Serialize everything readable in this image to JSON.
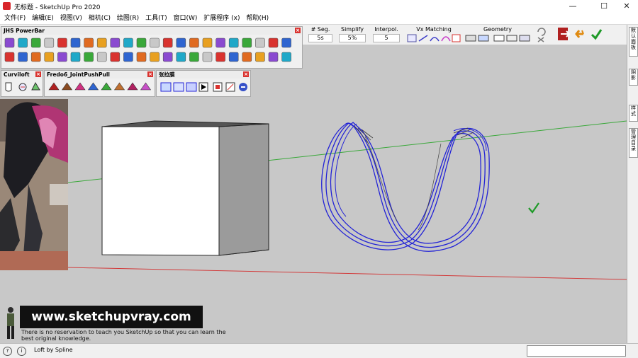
{
  "window": {
    "title": "无标题 - SketchUp Pro 2020"
  },
  "menu": [
    "文件(F)",
    "编辑(E)",
    "视图(V)",
    "相机(C)",
    "绘图(R)",
    "工具(T)",
    "窗口(W)",
    "扩展程序 (x)",
    "帮助(H)"
  ],
  "panels": {
    "jhs": {
      "title": "JHS PowerBar"
    },
    "curviloft": {
      "title": "Curviloft"
    },
    "fredo": {
      "title": "Fredo6_JointPushPull"
    },
    "zhang": {
      "title": "张拉膜"
    }
  },
  "spline_toolbar": {
    "seg": {
      "label": "# Seg.",
      "value": "5s"
    },
    "simplify": {
      "label": "Simplify",
      "value": "5%"
    },
    "interpol": {
      "label": "Interpol.",
      "value": "5"
    },
    "vx": {
      "label": "Vx Matching"
    },
    "geometry": {
      "label": "Geometry"
    }
  },
  "right_tabs": [
    "默认面板",
    "阴影",
    "样式",
    "管理目录"
  ],
  "status": {
    "text": "Loft by Spline"
  },
  "watermark": {
    "site": "www.sketchupvray.com",
    "subtitle": "There is no reservation to teach you SketchUp so that you can learn the best original knowledge."
  },
  "colors": {
    "accent_red": "#d9332f",
    "curve_blue": "#2323d6",
    "axis_green": "#3aa83a",
    "axis_red": "#d23a3a",
    "viewport": "#c8c8c8"
  }
}
